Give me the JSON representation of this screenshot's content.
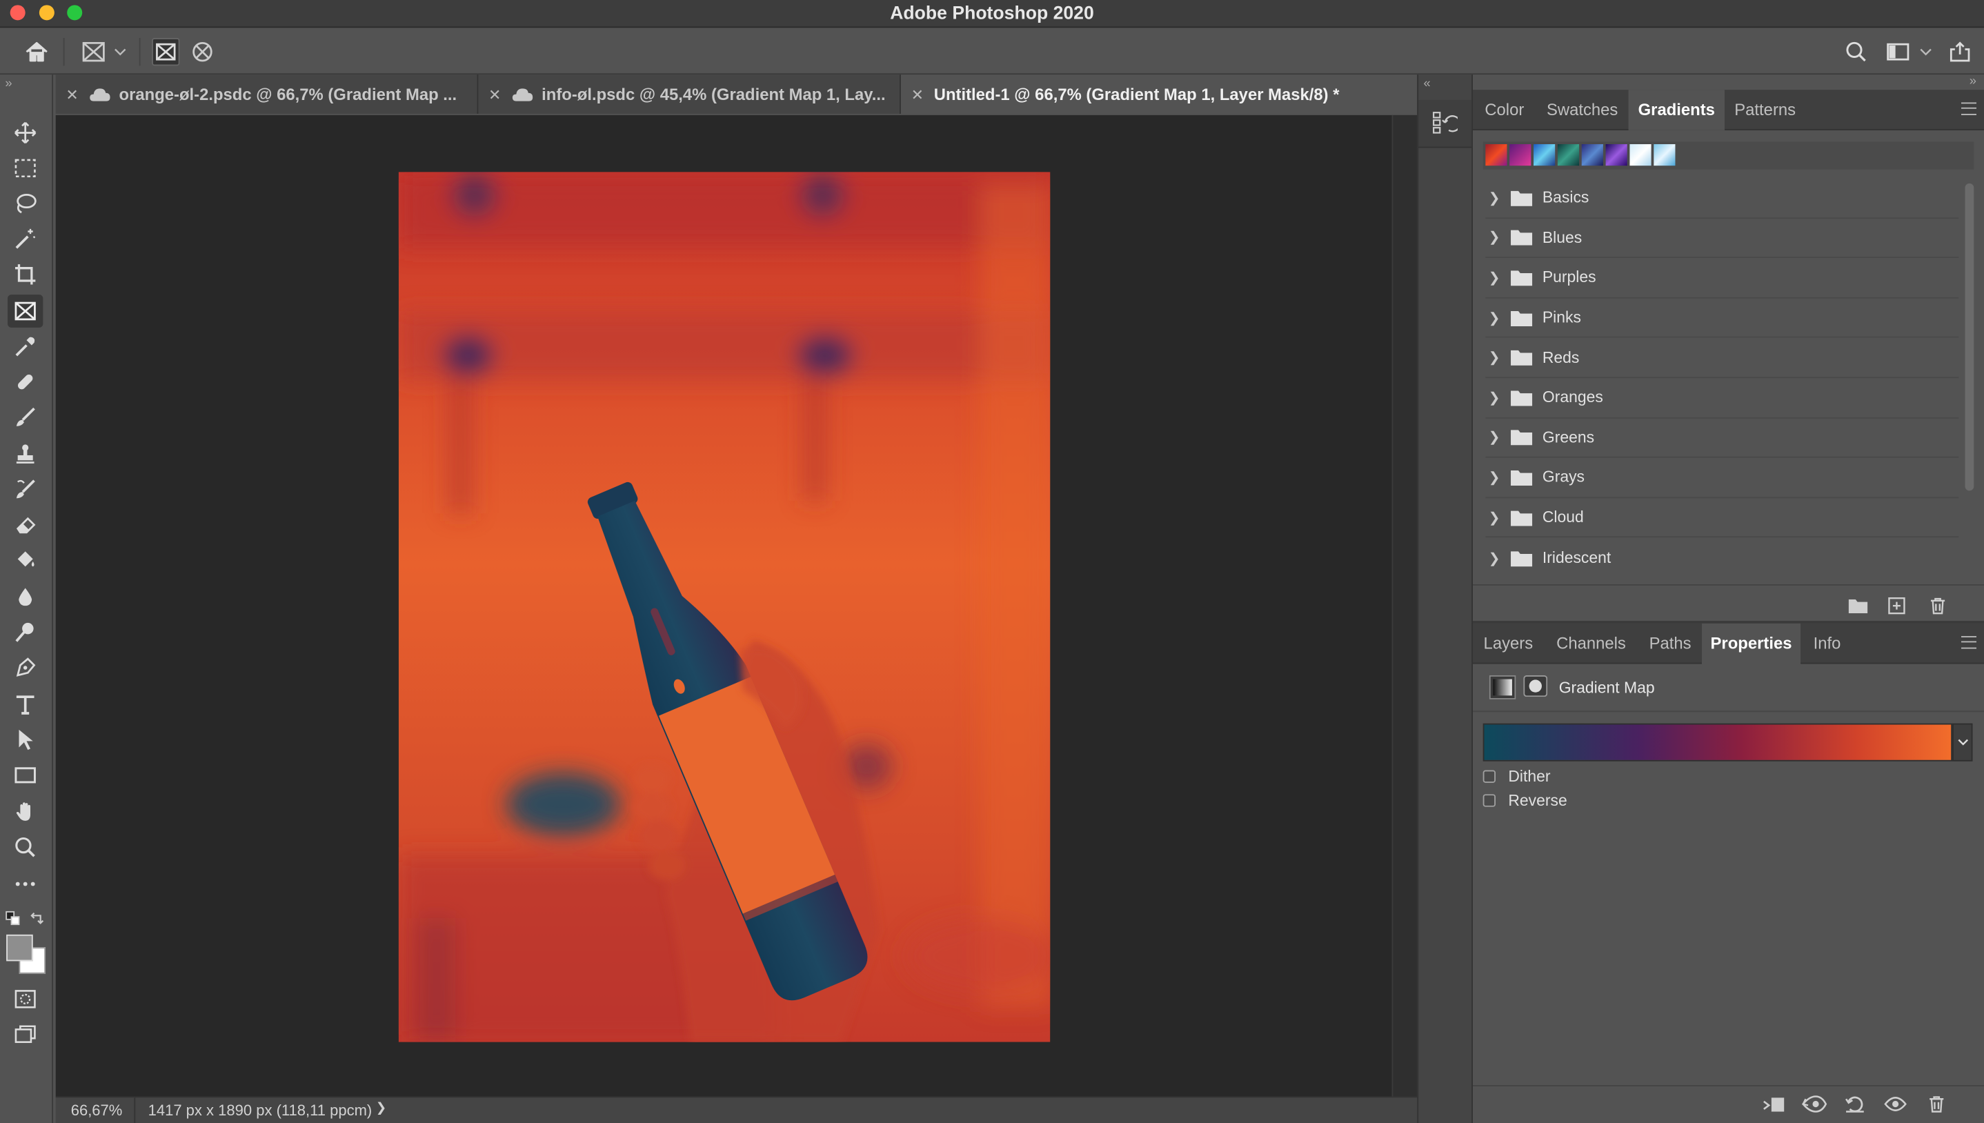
{
  "window": {
    "title": "Adobe Photoshop 2020",
    "traffic_lights": {
      "close": "#fe5f57",
      "minimize": "#febc2e",
      "maximize": "#28c840"
    }
  },
  "options_bar": {
    "icons": [
      "home-icon",
      "frame-tool-icon",
      "chevron-down-icon",
      "rectangle-frame-icon",
      "ellipse-frame-icon",
      "search-icon",
      "workspace-icon",
      "share-icon"
    ]
  },
  "tabs": [
    {
      "label": "orange-øl-2.psdc @ 66,7% (Gradient Map ...",
      "cloud": true,
      "active": false
    },
    {
      "label": "info-øl.psdc @ 45,4% (Gradient Map 1, Lay...",
      "cloud": true,
      "active": false
    },
    {
      "label": "Untitled-1 @ 66,7% (Gradient Map 1, Layer Mask/8) *",
      "cloud": false,
      "active": true
    }
  ],
  "status": {
    "zoom": "66,67%",
    "doc_info": "1417 px x 1890 px (118,11 ppcm)",
    "arrow": "❯"
  },
  "gradients_panel": {
    "tabs": [
      "Color",
      "Swatches",
      "Gradients",
      "Patterns"
    ],
    "active_tab": "Gradients",
    "groups": [
      "Basics",
      "Blues",
      "Purples",
      "Pinks",
      "Reds",
      "Oranges",
      "Greens",
      "Grays",
      "Cloud",
      "Iridescent"
    ]
  },
  "properties_panel": {
    "tabs": [
      "Layers",
      "Channels",
      "Paths",
      "Properties",
      "Info"
    ],
    "active_tab": "Properties",
    "title": "Gradient Map",
    "gradient_colors": [
      "#0d4a5c",
      "#4a2160",
      "#8b1f3f",
      "#d2432a",
      "#f26d2b"
    ],
    "options": [
      {
        "label": "Dither",
        "checked": false
      },
      {
        "label": "Reverse",
        "checked": false
      }
    ]
  },
  "colors": {
    "ui_dark": "#535353",
    "canvas_bg": "#282828",
    "image_orange": "#e8612d",
    "image_navy": "#1a4560"
  }
}
